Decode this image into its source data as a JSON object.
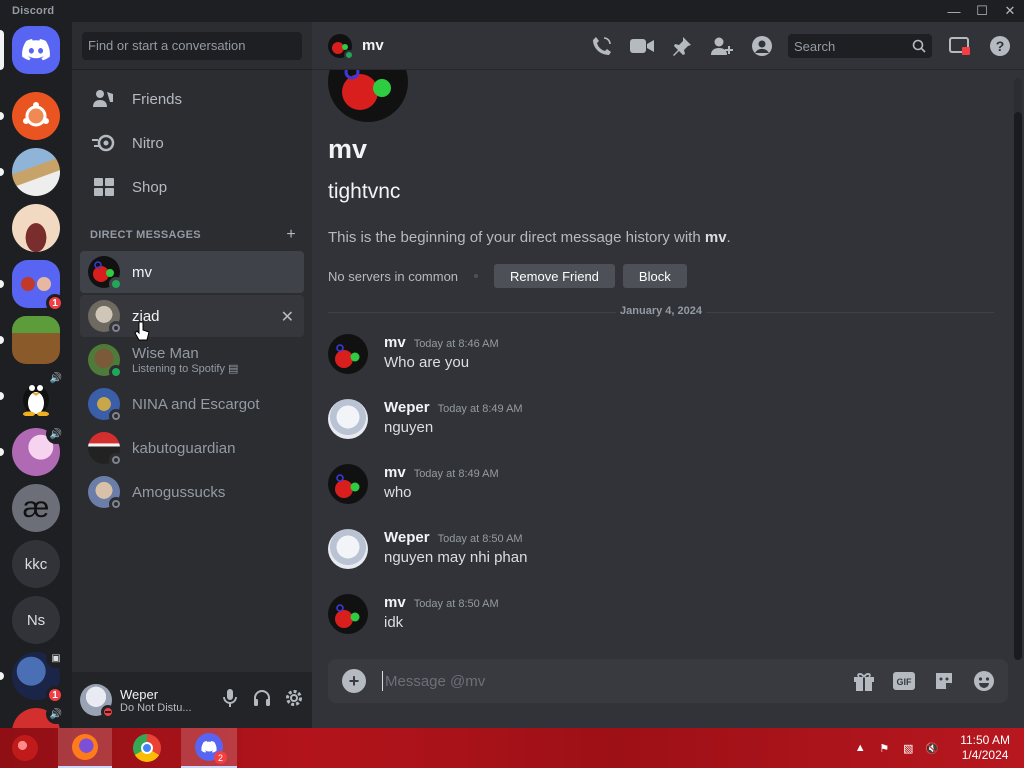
{
  "app": {
    "name": "Discord"
  },
  "servers": [
    {
      "key": "home",
      "label": "",
      "badge": "",
      "vol": false
    },
    {
      "key": "ubuntu",
      "label": "",
      "badge": "",
      "vol": false
    },
    {
      "key": "piano-cat",
      "label": "",
      "badge": "",
      "vol": false
    },
    {
      "key": "dish",
      "label": "",
      "badge": "",
      "vol": false
    },
    {
      "key": "group",
      "label": "",
      "badge": "1",
      "vol": false
    },
    {
      "key": "minecraft",
      "label": "",
      "badge": "",
      "vol": false
    },
    {
      "key": "tux",
      "label": "",
      "badge": "",
      "vol": true
    },
    {
      "key": "anime",
      "label": "",
      "badge": "",
      "vol": true
    },
    {
      "key": "ae",
      "label": "æ",
      "badge": "",
      "vol": false
    },
    {
      "key": "kkc",
      "label": "kkc",
      "badge": "",
      "vol": false
    },
    {
      "key": "ns",
      "label": "Ns",
      "badge": "",
      "vol": false
    },
    {
      "key": "blue",
      "label": "",
      "badge": "1",
      "vol": false
    },
    {
      "key": "santa",
      "label": "",
      "badge": "",
      "vol": true
    }
  ],
  "sidebar": {
    "search_placeholder": "Find or start a conversation",
    "nav": [
      {
        "label": "Friends",
        "icon": "friends-icon"
      },
      {
        "label": "Nitro",
        "icon": "nitro-icon"
      },
      {
        "label": "Shop",
        "icon": "shop-icon"
      }
    ],
    "dm_header": "DIRECT MESSAGES",
    "dms": [
      {
        "name": "mv",
        "status": "online",
        "sub": "",
        "state": "active"
      },
      {
        "name": "ziad",
        "status": "offline",
        "sub": "",
        "state": "hover"
      },
      {
        "name": "Wise Man",
        "status": "online",
        "sub": "Listening to Spotify",
        "state": ""
      },
      {
        "name": "NINA and Escargot",
        "status": "offline",
        "sub": "",
        "state": ""
      },
      {
        "name": "kabutoguardian",
        "status": "offline",
        "sub": "",
        "state": ""
      },
      {
        "name": "Amogussucks",
        "status": "offline",
        "sub": "",
        "state": ""
      }
    ]
  },
  "user_panel": {
    "name": "Weper",
    "status": "Do Not Distu..."
  },
  "header": {
    "name": "mv",
    "search_placeholder": "Search"
  },
  "intro": {
    "display_name": "mv",
    "username": "tightvnc",
    "text_prefix": "This is the beginning of your direct message history with ",
    "text_name": "mv",
    "text_suffix": ".",
    "mutual": "No servers in common",
    "remove_label": "Remove Friend",
    "block_label": "Block"
  },
  "date_divider": "January 4, 2024",
  "messages": [
    {
      "author": "mv",
      "time": "Today at 8:46 AM",
      "text": "Who are you",
      "avatar": "gears"
    },
    {
      "author": "Weper",
      "time": "Today at 8:49 AM",
      "text": "nguyen",
      "avatar": "anime"
    },
    {
      "author": "mv",
      "time": "Today at 8:49 AM",
      "text": "who",
      "avatar": "gears"
    },
    {
      "author": "Weper",
      "time": "Today at 8:50 AM",
      "text": "nguyen may nhi phan",
      "avatar": "anime"
    },
    {
      "author": "mv",
      "time": "Today at 8:50 AM",
      "text": "idk",
      "avatar": "gears"
    }
  ],
  "composer": {
    "placeholder": "Message @mv",
    "gif_label": "GIF"
  },
  "taskbar": {
    "time": "11:50 AM",
    "date": "1/4/2024",
    "discord_badge": "2"
  },
  "colors": {
    "blurple": "#5865f2",
    "online": "#23a55a",
    "dnd": "#f23f43",
    "taskbar": "#b3141b"
  }
}
